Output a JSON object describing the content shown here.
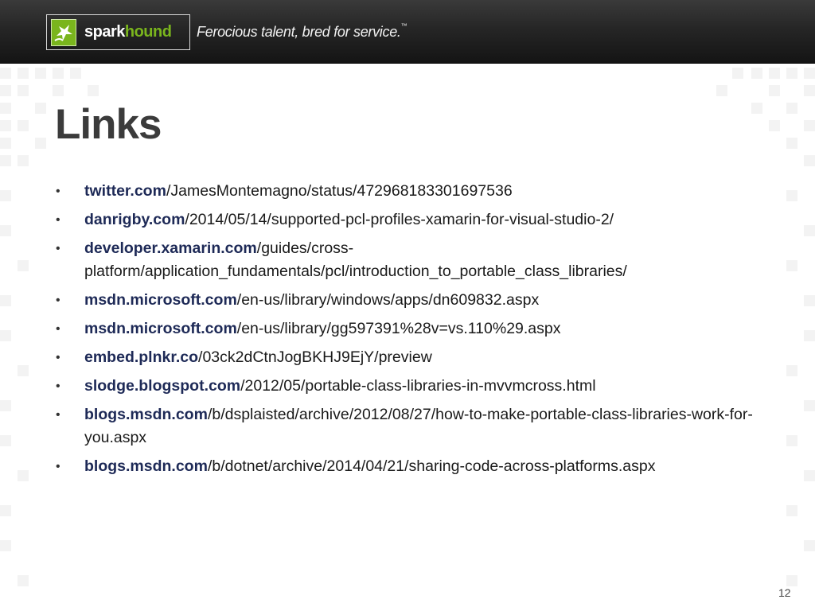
{
  "header": {
    "logo_text_a": "spark",
    "logo_text_b": "hound",
    "tagline": "Ferocious talent, bred for service.",
    "tagline_mark": "™"
  },
  "slide": {
    "title": "Links",
    "page_number": "12",
    "bullet_char": "•",
    "links": [
      {
        "domain": "twitter.com",
        "path": "/JamesMontemagno/status/472968183301697536"
      },
      {
        "domain": "danrigby.com",
        "path": "/2014/05/14/supported-pcl-profiles-xamarin-for-visual-studio-2/"
      },
      {
        "domain": "developer.xamarin.com",
        "path": "/guides/cross-platform/application_fundamentals/pcl/introduction_to_portable_class_libraries/"
      },
      {
        "domain": "msdn.microsoft.com",
        "path": "/en-us/library/windows/apps/dn609832.aspx"
      },
      {
        "domain": "msdn.microsoft.com",
        "path": "/en-us/library/gg597391%28v=vs.110%29.aspx"
      },
      {
        "domain": "embed.plnkr.co",
        "path": "/03ck2dCtnJogBKHJ9EjY/preview"
      },
      {
        "domain": "slodge.blogspot.com",
        "path": "/2012/05/portable-class-libraries-in-mvvmcross.html"
      },
      {
        "domain": "blogs.msdn.com",
        "path": "/b/dsplaisted/archive/2012/08/27/how-to-make-portable-class-libraries-work-for-you.aspx"
      },
      {
        "domain": "blogs.msdn.com",
        "path": "/b/dotnet/archive/2014/04/21/sharing-code-across-platforms.aspx"
      }
    ]
  },
  "colors": {
    "header_bg": "#1e1e1e",
    "brand_green": "#7ab51d",
    "title": "#3b3b3b",
    "link_domain": "#1e2a57",
    "pattern_square": "#f2f2f2"
  }
}
